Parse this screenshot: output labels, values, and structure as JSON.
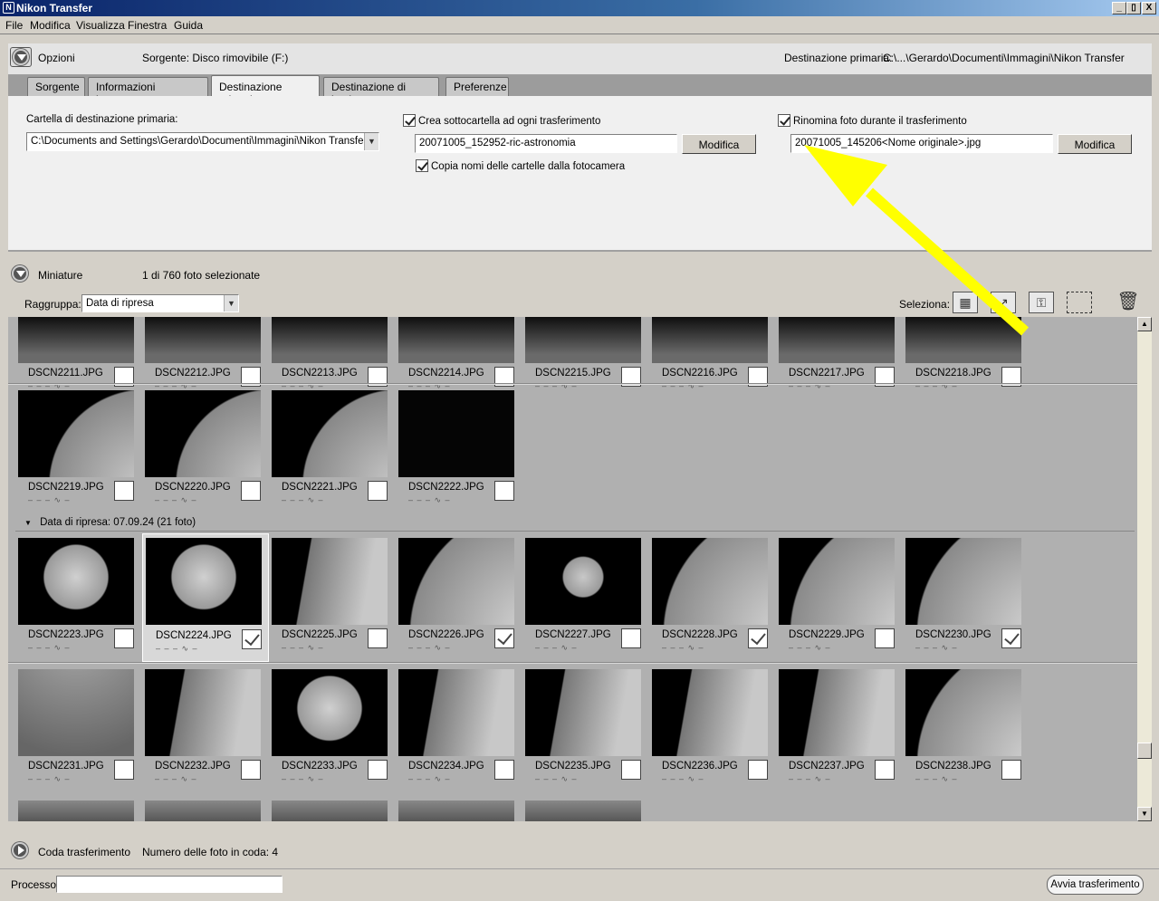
{
  "window": {
    "title": "Nikon Transfer",
    "controls": [
      "_",
      "▯",
      "X"
    ]
  },
  "menu": [
    "File",
    "Modifica",
    "Visualizza",
    "Finestra",
    "Guida"
  ],
  "options": {
    "label": "Opzioni",
    "source": "Sorgente: Disco rimovibile (F:)",
    "primary_dest_label": "Destinazione primaria:",
    "primary_dest_path": "C:\\...\\Gerardo\\Documenti\\Immagini\\Nikon Transfer",
    "tabs": [
      "Sorgente",
      "Informazioni incorporate",
      "Destinazione primaria",
      "Destinazione di backup",
      "Preferenze"
    ],
    "active_tab": "Destinazione primaria",
    "folder_label": "Cartella di destinazione primaria:",
    "folder_value": "C:\\Documents and Settings\\Gerardo\\Documenti\\Immagini\\Nikon Transfer",
    "subfolder_check_label": "Crea sottocartella ad ogni trasferimento",
    "subfolder_value": "20071005_152952-ric-astronomia",
    "modify_label": "Modifica",
    "copy_names_label": "Copia nomi delle cartelle dalla fotocamera",
    "rename_check_label": "Rinomina foto durante il trasferimento",
    "rename_value": "20071005_145206<Nome originale>.jpg"
  },
  "thumbs_panel": {
    "label": "Miniature",
    "selected_info": "1 di 760 foto selezionate",
    "group_label": "Raggruppa:",
    "group_value": "Data di ripresa",
    "select_label": "Seleziona:",
    "group_header": "Data di ripresa: 07.09.24 (21 foto)",
    "dashes": "– – – ∿ –",
    "rows": [
      [
        "DSCN2211.JPG",
        "DSCN2212.JPG",
        "DSCN2213.JPG",
        "DSCN2214.JPG",
        "DSCN2215.JPG",
        "DSCN2216.JPG",
        "DSCN2217.JPG",
        "DSCN2218.JPG"
      ],
      [
        "DSCN2219.JPG",
        "DSCN2220.JPG",
        "DSCN2221.JPG",
        "DSCN2222.JPG"
      ],
      [
        "DSCN2223.JPG",
        "DSCN2224.JPG",
        "DSCN2225.JPG",
        "DSCN2226.JPG",
        "DSCN2227.JPG",
        "DSCN2228.JPG",
        "DSCN2229.JPG",
        "DSCN2230.JPG"
      ],
      [
        "DSCN2231.JPG",
        "DSCN2232.JPG",
        "DSCN2233.JPG",
        "DSCN2234.JPG",
        "DSCN2235.JPG",
        "DSCN2236.JPG",
        "DSCN2237.JPG",
        "DSCN2238.JPG"
      ]
    ],
    "checked": [
      "DSCN2224.JPG",
      "DSCN2226.JPG",
      "DSCN2228.JPG",
      "DSCN2230.JPG"
    ],
    "highlighted": "DSCN2224.JPG"
  },
  "queue": {
    "label": "Coda trasferimento",
    "info": "Numero delle foto in coda: 4"
  },
  "footer": {
    "process_label": "Processo:",
    "start_button": "Avvia trasferimento"
  },
  "annotation": {
    "arrow_color": "#ffff00"
  }
}
